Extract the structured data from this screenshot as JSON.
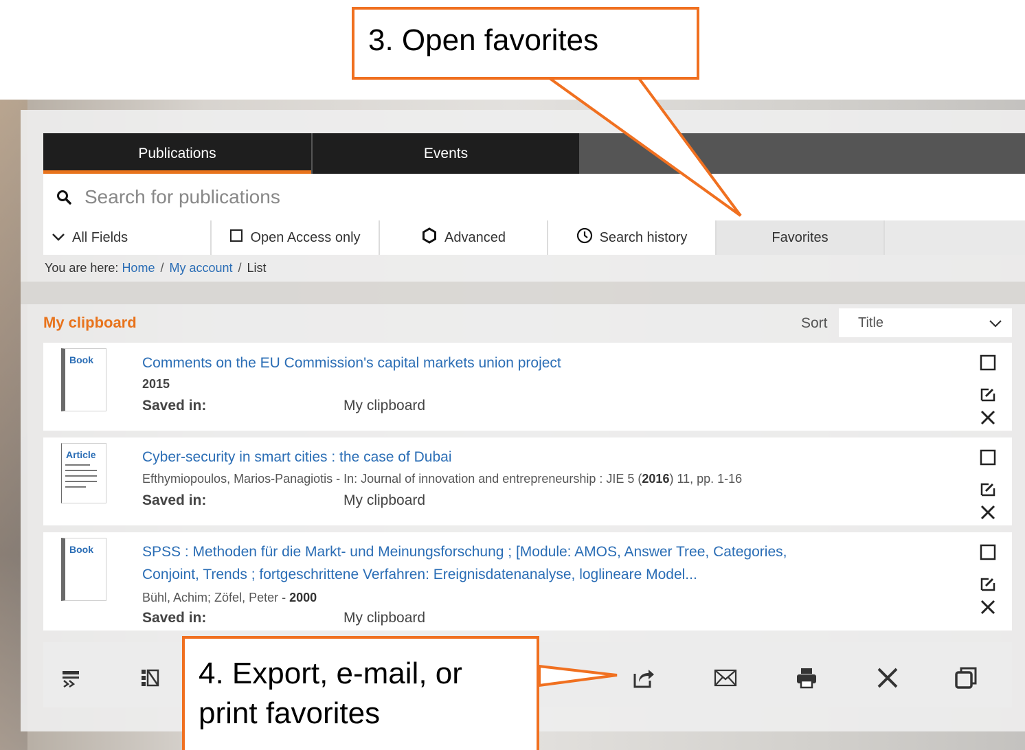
{
  "tabs": [
    {
      "label": "Publications"
    },
    {
      "label": "Events"
    }
  ],
  "search": {
    "placeholder": "Search for publications"
  },
  "options": {
    "fields": "All Fields",
    "open_access": "Open Access only",
    "advanced": "Advanced",
    "history": "Search history",
    "favorites": "Favorites"
  },
  "breadcrumb": {
    "prefix": "You are here:",
    "home": "Home",
    "account": "My account",
    "current": "List",
    "separator": "/"
  },
  "clipboard": {
    "title": "My clipboard",
    "sort_label": "Sort",
    "sort_value": "Title"
  },
  "items": [
    {
      "type": "Book",
      "title": "Comments on the EU Commission's capital markets union project",
      "meta": "2015",
      "saved_label": "Saved in:",
      "saved_in": "My clipboard"
    },
    {
      "type": "Article",
      "title": "Cyber-security in smart cities : the case of Dubai",
      "meta_prefix": "Efthymiopoulos, Marios-Panagiotis - In: Journal of innovation and entrepreneurship : JIE 5 (",
      "meta_year": "2016",
      "meta_suffix": ") 11, pp. 1-16",
      "saved_label": "Saved in:",
      "saved_in": "My clipboard"
    },
    {
      "type": "Book",
      "title_line1": "SPSS : Methoden für die Markt- und Meinungsforschung ; [Module: AMOS, Answer Tree, Categories,",
      "title_line2": "Conjoint, Trends ; fortgeschrittene Verfahren: Ereignisdatenanalyse, loglineare Model...",
      "meta_prefix": "Bühl, Achim; Zöfel, Peter - ",
      "meta_year": "2000",
      "saved_label": "Saved in:",
      "saved_in": "My clipboard"
    }
  ],
  "callouts": {
    "open_favorites": "3. Open favorites",
    "export_line1": "4. Export, e-mail, or",
    "export_line2": "print favorites"
  },
  "colors": {
    "accent": "#e8731c",
    "callout_border": "#f07020",
    "link": "#2a6db5",
    "tab_bg": "#1e1e1e"
  },
  "toolbar_icons": [
    "select-all-icon",
    "deselect-icon",
    "export-icon",
    "email-icon",
    "print-icon",
    "delete-icon",
    "copy-icon"
  ]
}
